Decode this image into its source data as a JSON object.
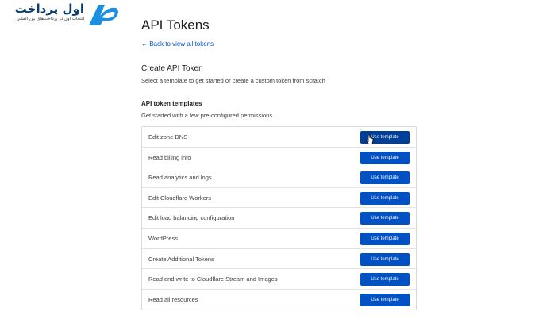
{
  "logo": {
    "main_text": "اول پرداخت",
    "sub_text": "انتخاب اول در پرداخت‌های بین المللی",
    "mark_text": "AP",
    "colors": {
      "primary": "#1b8fe0",
      "dark": "#0a3d6b"
    }
  },
  "page": {
    "title": "API Tokens",
    "back_link": "← Back to view all tokens"
  },
  "create_section": {
    "title": "Create API Token",
    "description": "Select a template to get started or create a custom token from scratch"
  },
  "templates_section": {
    "title": "API token templates",
    "description": "Get started with a few pre-configured permissions.",
    "button_label": "Use template",
    "items": [
      {
        "name": "Edit zone DNS"
      },
      {
        "name": "Read billing info"
      },
      {
        "name": "Read analytics and logs"
      },
      {
        "name": "Edit Cloudflare Workers"
      },
      {
        "name": "Edit load balancing configuration"
      },
      {
        "name": "WordPress"
      },
      {
        "name": "Create Additional Tokens"
      },
      {
        "name": "Read and write to Cloudflare Stream and Images"
      },
      {
        "name": "Read all resources"
      }
    ]
  },
  "colors": {
    "accent": "#0051c3",
    "accent_hover": "#003f97",
    "border": "#d9d9d9"
  }
}
